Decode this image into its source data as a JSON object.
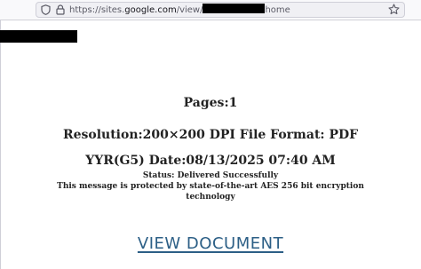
{
  "browser": {
    "url_prefix": "https://sites.",
    "url_domain": "google.com",
    "url_path": "/view/",
    "url_suffix": "home",
    "icons": {
      "tracking": "shield-icon",
      "security": "lock-icon",
      "bookmark": "star-icon"
    }
  },
  "document": {
    "pages": "Pages:1",
    "resolution": "Resolution:200×200 DPI File Format: PDF",
    "ref_date": "YYR(G5) Date:08/13/2025 07:40 AM",
    "status": "Status: Delivered Successfully",
    "protection_line1": "This message is protected by state-of-the-art AES 256 bit encryption",
    "protection_line2": "technology"
  },
  "cta": {
    "label": "VIEW DOCUMENT"
  },
  "colors": {
    "link": "#2c5f86",
    "text": "#222222"
  }
}
